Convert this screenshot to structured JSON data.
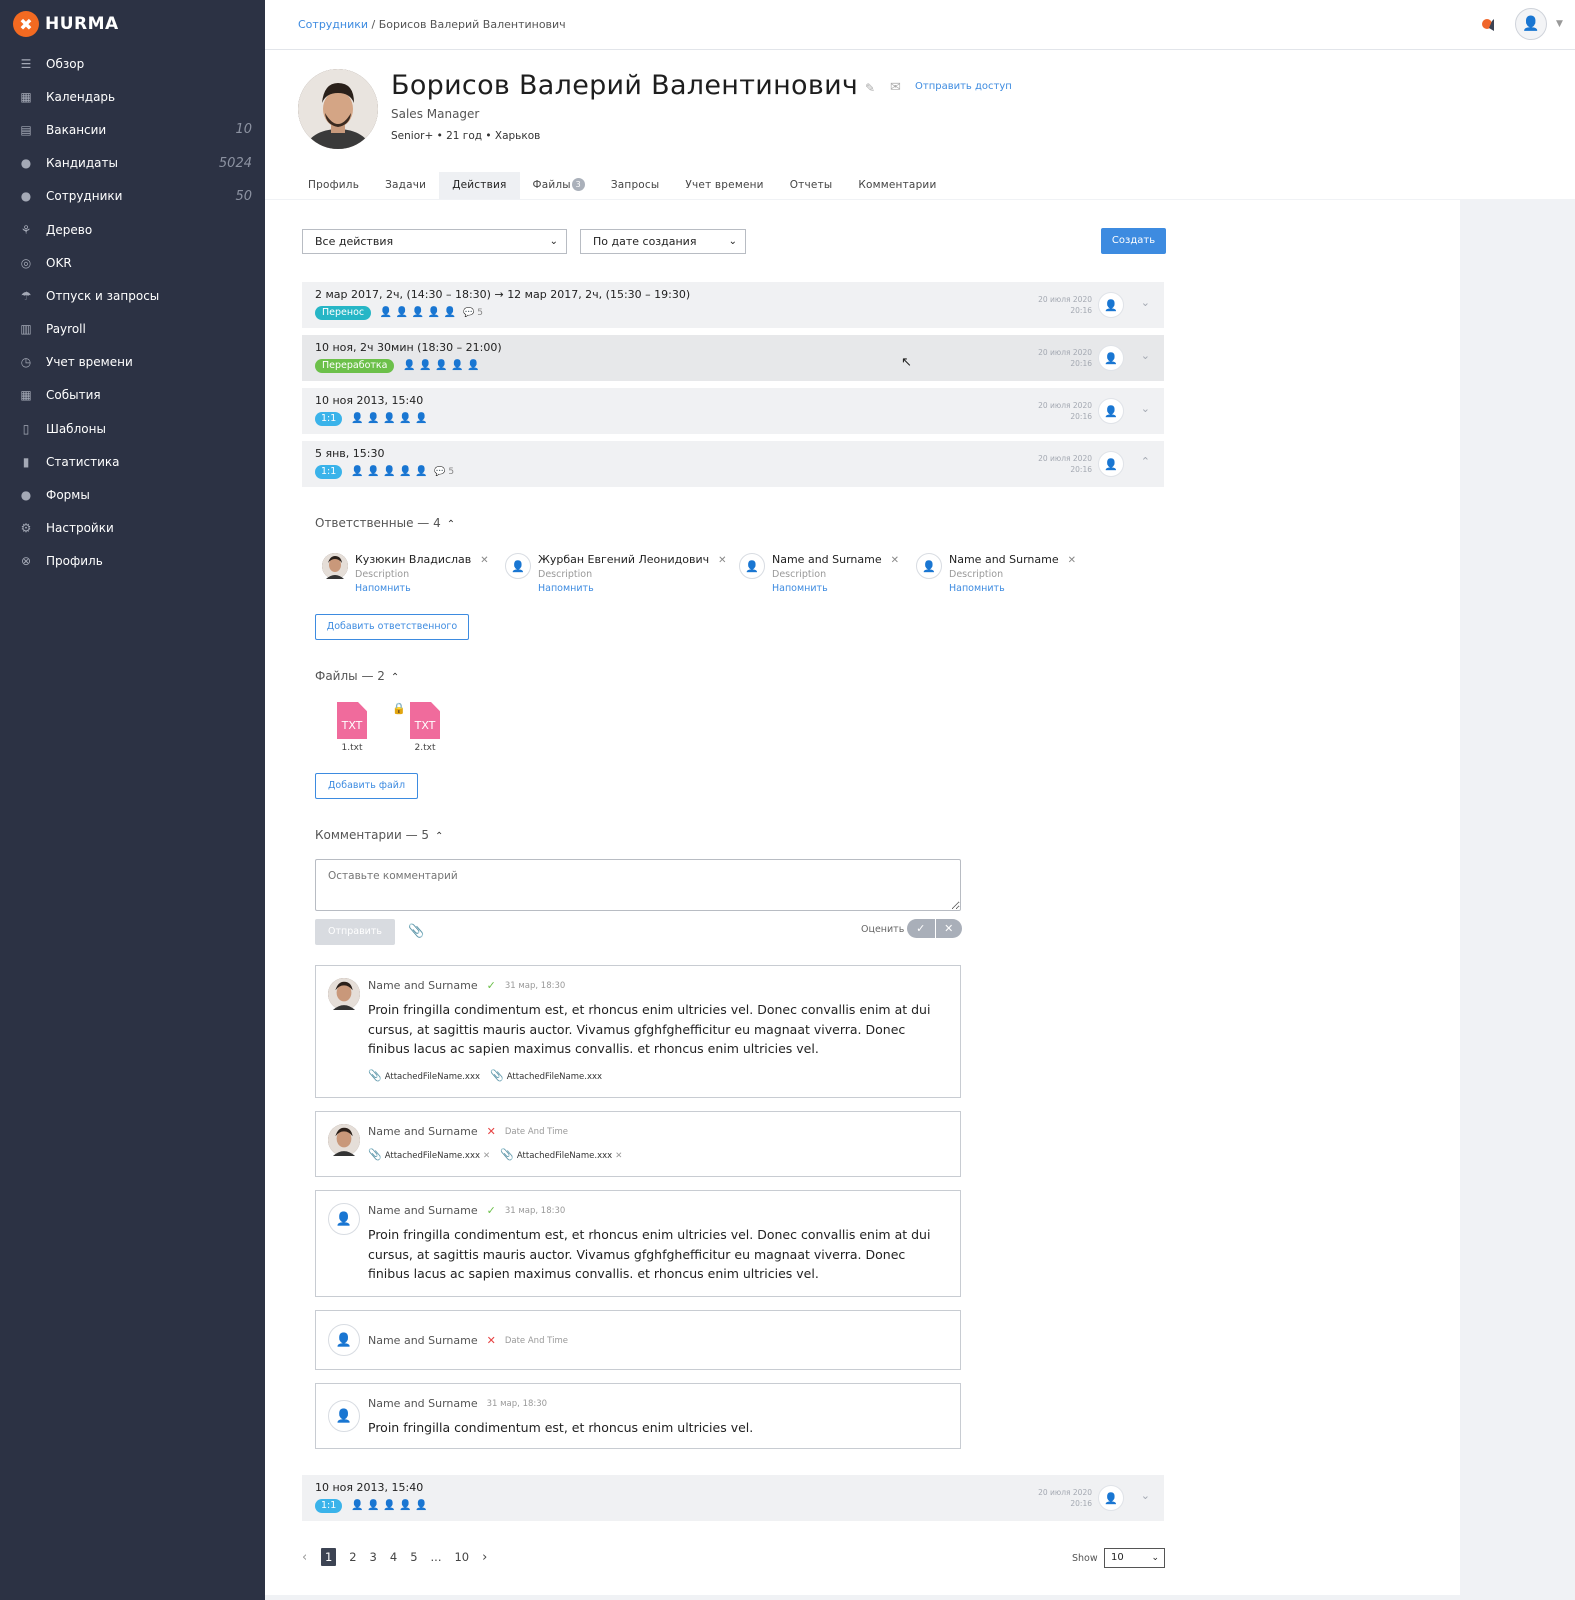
{
  "app": {
    "logo_text": "HURMA",
    "logo_mark": "✖",
    "accent_color": "#3d8be0",
    "sidebar_color": "#2c3244"
  },
  "sidebar": {
    "items": [
      {
        "label": "Обзор",
        "icon": "overview-icon",
        "count": ""
      },
      {
        "label": "Календарь",
        "icon": "calendar-icon",
        "count": ""
      },
      {
        "label": "Вакансии",
        "icon": "vacancies-icon",
        "count": "10"
      },
      {
        "label": "Кандидаты",
        "icon": "candidates-icon",
        "count": "5024"
      },
      {
        "label": "Сотрудники",
        "icon": "employees-icon",
        "count": "50"
      },
      {
        "label": "Дерево",
        "icon": "tree-icon",
        "count": ""
      },
      {
        "label": "OKR",
        "icon": "okr-icon",
        "count": ""
      },
      {
        "label": "Отпуск и запросы",
        "icon": "vacation-icon",
        "count": ""
      },
      {
        "label": "Payroll",
        "icon": "payroll-icon",
        "count": ""
      },
      {
        "label": "Учет времени",
        "icon": "time-tracking-icon",
        "count": ""
      },
      {
        "label": "События",
        "icon": "events-icon",
        "count": ""
      },
      {
        "label": "Шаблоны",
        "icon": "templates-icon",
        "count": ""
      },
      {
        "label": "Статистика",
        "icon": "statistics-icon",
        "count": ""
      },
      {
        "label": "Формы",
        "icon": "forms-icon",
        "count": ""
      },
      {
        "label": "Настройки",
        "icon": "settings-icon",
        "count": ""
      },
      {
        "label": "Профиль",
        "icon": "profile-icon",
        "count": ""
      }
    ]
  },
  "header": {
    "breadcrumb_link": "Сотрудники",
    "breadcrumb_sep": " / ",
    "breadcrumb_current": "Борисов Валерий Валентинович"
  },
  "profile": {
    "name": "Борисов Валерий Валентинович",
    "send_access": "Отправить доступ",
    "position": "Sales Manager",
    "meta": "Senior+ • 21 год • Харьков"
  },
  "tabs": [
    {
      "label": "Профиль",
      "badge": ""
    },
    {
      "label": "Задачи",
      "badge": ""
    },
    {
      "label": "Действия",
      "badge": ""
    },
    {
      "label": "Файлы",
      "badge": "3"
    },
    {
      "label": "Запросы",
      "badge": ""
    },
    {
      "label": "Учет времени",
      "badge": ""
    },
    {
      "label": "Отчеты",
      "badge": ""
    },
    {
      "label": "Комментарии",
      "badge": ""
    }
  ],
  "filters": {
    "action_type": "Все действия",
    "sort": "По дате создания",
    "create_label": "Создать"
  },
  "actions": [
    {
      "title": "2 мар 2017, 2ч, (14:30 – 18:30)",
      "arrow": "→",
      "title2": "12 мар 2017, 2ч, (15:30 – 19:30)",
      "tag": "Перенос",
      "comments": "5",
      "date": "20 июля 2020",
      "time": "20:16"
    },
    {
      "title": "10 ноя, 2ч 30мин (18:30 – 21:00)",
      "tag": "Переработка",
      "comments": "",
      "date": "20 июля 2020",
      "time": "20:16"
    },
    {
      "title": "10 ноя 2013, 15:40",
      "tag": "1:1",
      "comments": "",
      "date": "20 июля 2020",
      "time": "20:16"
    },
    {
      "title": "5 янв, 15:30",
      "tag": "1:1",
      "comments": "5",
      "date": "20 июля 2020",
      "time": "20:16"
    },
    {
      "title": "10 ноя 2013, 15:40",
      "tag": "1:1",
      "comments": "",
      "date": "20 июля 2020",
      "time": "20:16"
    }
  ],
  "responsible": {
    "title": "Ответственные — 4",
    "people": [
      {
        "name": "Кузюкин Владислав",
        "desc": "Description",
        "remind": "Напомнить"
      },
      {
        "name": "Журбан Евгений Леонидович",
        "desc": "Description",
        "remind": "Напомнить"
      },
      {
        "name": "Name and Surname",
        "desc": "Description",
        "remind": "Напомнить"
      },
      {
        "name": "Name and Surname",
        "desc": "Description",
        "remind": "Напомнить"
      }
    ],
    "add_label": "Добавить ответственного"
  },
  "files": {
    "title": "Файлы — 2",
    "items": [
      {
        "ext": "TXT",
        "name": "1.txt"
      },
      {
        "ext": "TXT",
        "name": "2.txt"
      }
    ],
    "add_label": "Добавить файл"
  },
  "comments": {
    "title": "Комментарии — 5",
    "placeholder": "Оставьте комментарий",
    "send_label": "Отправить",
    "rate_label": "Оценить",
    "items": [
      {
        "name": "Name and Surname",
        "date": "31 мар, 18:30",
        "text": "Proin fringilla condimentum est, et rhoncus enim ultricies vel. Donec convallis enim at dui cursus, at sagittis mauris auctor. Vivamus gfghfghefficitur eu magnaat viverra. Donec finibus lacus ac sapien maximus convallis. et rhoncus enim ultricies vel.",
        "files": [
          "AttachedFileName.xxx",
          "AttachedFileName.xxx"
        ]
      },
      {
        "name": "Name and Surname",
        "date": "Date And Time",
        "text": "",
        "files": [
          "AttachedFileName.xxx",
          "AttachedFileName.xxx"
        ]
      },
      {
        "name": "Name and Surname",
        "date": "31 мар, 18:30",
        "text": "Proin fringilla condimentum est, et rhoncus enim ultricies vel. Donec convallis enim at dui cursus, at sagittis mauris auctor. Vivamus gfghfghefficitur eu magnaat viverra. Donec finibus lacus ac sapien maximus convallis. et rhoncus enim ultricies vel.",
        "files": []
      },
      {
        "name": "Name and Surname",
        "date": "Date And Time",
        "text": "",
        "files": []
      },
      {
        "name": "Name and Surname",
        "date": "31 мар, 18:30",
        "text": "Proin fringilla condimentum est, et rhoncus enim ultricies vel.",
        "files": []
      }
    ]
  },
  "pagination": {
    "pages": [
      "1",
      "2",
      "3",
      "4",
      "5",
      "...",
      "10"
    ],
    "show_label": "Show",
    "show_value": "10"
  }
}
